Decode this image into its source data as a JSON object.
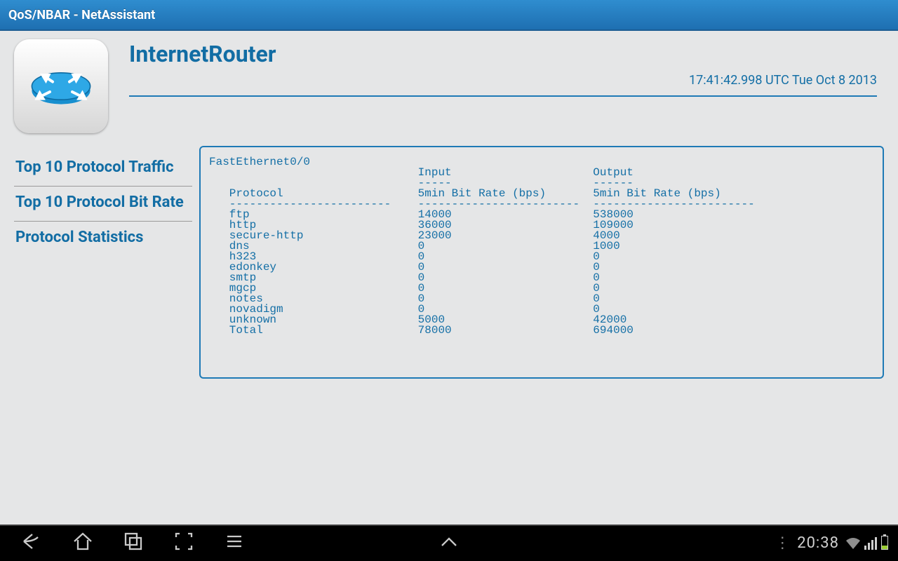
{
  "appbar": {
    "title": "QoS/NBAR - NetAssistant"
  },
  "header": {
    "device": "InternetRouter",
    "timestamp": "17:41:42.998 UTC Tue Oct 8 2013"
  },
  "tabs": [
    "Top 10 Protocol Traffic",
    "Top 10 Protocol Bit Rate",
    "Protocol Statistics"
  ],
  "report": {
    "interface": "FastEthernet0/0",
    "col1_header_top": "Input",
    "col2_header_top": "Output",
    "protocol_header": "Protocol",
    "rate_header": "5min Bit Rate (bps)",
    "rows": [
      {
        "protocol": "ftp",
        "input": "14000",
        "output": "538000"
      },
      {
        "protocol": "http",
        "input": "36000",
        "output": "109000"
      },
      {
        "protocol": "secure-http",
        "input": "23000",
        "output": "4000"
      },
      {
        "protocol": "dns",
        "input": "0",
        "output": "1000"
      },
      {
        "protocol": "h323",
        "input": "0",
        "output": "0"
      },
      {
        "protocol": "edonkey",
        "input": "0",
        "output": "0"
      },
      {
        "protocol": "smtp",
        "input": "0",
        "output": "0"
      },
      {
        "protocol": "mgcp",
        "input": "0",
        "output": "0"
      },
      {
        "protocol": "notes",
        "input": "0",
        "output": "0"
      },
      {
        "protocol": "novadigm",
        "input": "0",
        "output": "0"
      },
      {
        "protocol": "unknown",
        "input": "5000",
        "output": "42000"
      },
      {
        "protocol": "Total",
        "input": "78000",
        "output": "694000"
      }
    ]
  },
  "navbar": {
    "clock": "20:38"
  }
}
